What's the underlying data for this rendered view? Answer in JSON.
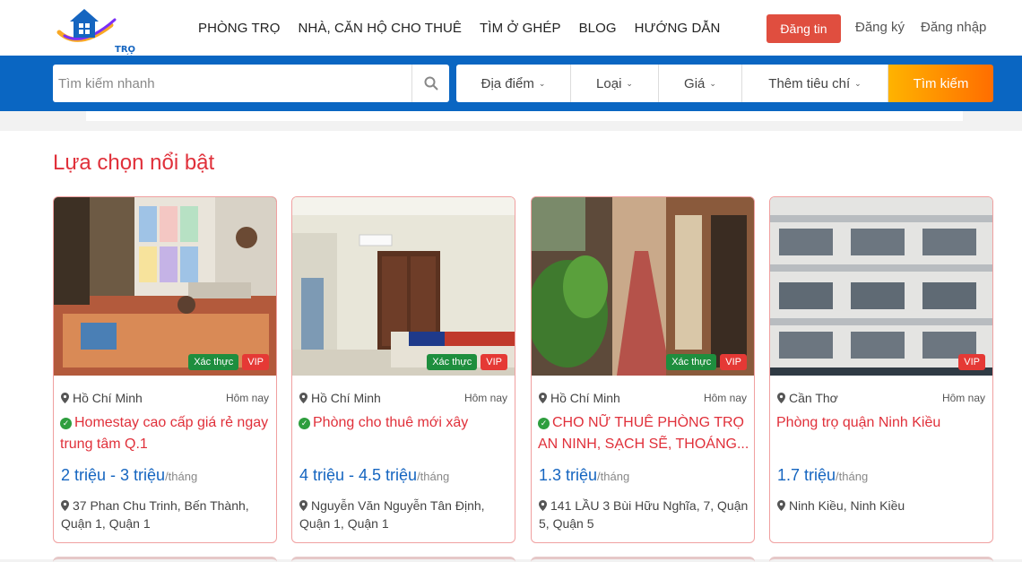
{
  "header": {
    "logo_text": "TRỌ MỚI",
    "nav": [
      "PHÒNG TRỌ",
      "NHÀ, CĂN HỘ CHO THUÊ",
      "TÌM Ở GHÉP",
      "BLOG",
      "HƯỚNG DẪN"
    ],
    "post_button": "Đăng tin",
    "register": "Đăng ký",
    "login": "Đăng nhập"
  },
  "search": {
    "placeholder": "Tìm kiếm nhanh",
    "filters": [
      "Địa điểm",
      "Loại",
      "Giá",
      "Thêm tiêu chí"
    ],
    "submit": "Tìm kiếm"
  },
  "section": {
    "title": "Lựa chọn nổi bật"
  },
  "listings": [
    {
      "location": "Hồ Chí Minh",
      "date": "Hôm nay",
      "title": "Homestay cao cấp giá rẻ ngay trung tâm Q.1",
      "verified_title": true,
      "price": "2 triệu - 3 triệu",
      "unit": "/tháng",
      "address": "37 Phan Chu Trinh, Bến Thành, Quận 1, Quận 1",
      "badge_verify": "Xác thực",
      "badge_vip": "VIP"
    },
    {
      "location": "Hồ Chí Minh",
      "date": "Hôm nay",
      "title": "Phòng cho thuê mới xây",
      "verified_title": true,
      "price": "4 triệu - 4.5 triệu",
      "unit": "/tháng",
      "address": "Nguyễn Văn Nguyễn Tân Định, Quận 1, Quận 1",
      "badge_verify": "Xác thực",
      "badge_vip": "VIP"
    },
    {
      "location": "Hồ Chí Minh",
      "date": "Hôm nay",
      "title": "CHO NỮ THUÊ PHÒNG TRỌ AN NINH, SẠCH SẼ, THOÁNG...",
      "verified_title": true,
      "price": "1.3 triệu",
      "unit": "/tháng",
      "address": "141 LẦU 3 Bùi Hữu Nghĩa, 7, Quận 5, Quận 5",
      "badge_verify": "Xác thực",
      "badge_vip": "VIP"
    },
    {
      "location": "Cần Thơ",
      "date": "Hôm nay",
      "title": "Phòng trọ quận Ninh Kiều",
      "verified_title": false,
      "price": "1.7 triệu",
      "unit": "/tháng",
      "address": "Ninh Kiều, Ninh Kiều",
      "badge_verify": "",
      "badge_vip": "VIP"
    }
  ],
  "colors": {
    "brand_blue": "#0a66c2",
    "accent_red": "#e0303a",
    "price_blue": "#1565c0",
    "verify_green": "#1e8e3e"
  },
  "icons": [
    "logo-house-icon",
    "search-icon",
    "chevron-down-icon",
    "map-pin-icon",
    "check-circle-icon"
  ]
}
